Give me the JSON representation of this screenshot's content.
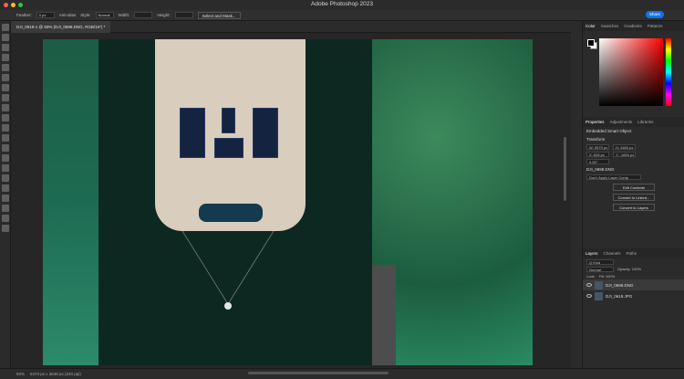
{
  "window": {
    "title": "Adobe Photoshop 2023"
  },
  "options": {
    "feather_label": "Feather:",
    "feather_value": "0 px",
    "antialias": "Anti-alias",
    "style_label": "Style:",
    "style_value": "Normal",
    "width_label": "Width:",
    "height_label": "Height:",
    "select_mask": "Select and Mask...",
    "share": "Share"
  },
  "tabs": [
    {
      "label": "DJI_0619-1 @ 50% (DJI_0698.DNG, RGB/16*) *"
    }
  ],
  "panels": {
    "color_tabs": [
      "Color",
      "Swatches",
      "Gradients",
      "Patterns"
    ],
    "properties_tabs": [
      "Properties",
      "Adjustments",
      "Libraries"
    ],
    "smart_object": "Embedded Smart Object",
    "transform": "Transform",
    "w": "W: 5570 px",
    "h": "H: 3484 px",
    "x": "X: 626 px",
    "y": "Y: -1654 px",
    "angle": "0.00°",
    "filename": "DJI_0698.DNG",
    "no_comp": "Don't Apply Layer Comp",
    "btn_edit": "Edit Contents",
    "btn_convert_linked": "Convert to Linked...",
    "btn_convert_layers": "Convert to Layers",
    "layers_tabs": [
      "Layers",
      "Channels",
      "Paths"
    ],
    "kind": "Q Kind",
    "blend": "Normal",
    "opacity": "Opacity: 100%",
    "lock": "Lock:",
    "fill": "Fill: 100%",
    "layers": [
      {
        "name": "DJI_0698.DNG"
      },
      {
        "name": "DJI_0619.JPG"
      }
    ]
  },
  "status": {
    "zoom": "50%",
    "size": "5473 px x 3648 px (240 ppi)"
  }
}
